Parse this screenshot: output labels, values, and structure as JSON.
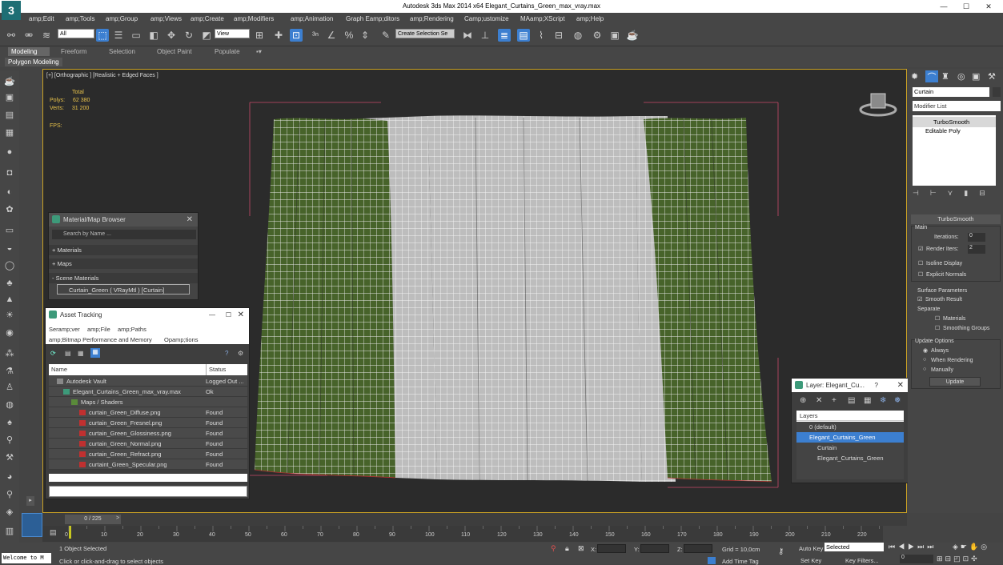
{
  "app": {
    "title": "Autodesk 3ds Max  2014 x64    Elegant_Curtains_Green_max_vray.max",
    "logo": "3"
  },
  "window_controls": {
    "minimize": "—",
    "maximize": "☐",
    "close": "✕"
  },
  "menu": [
    "amp;Edit",
    "amp;Tools",
    "amp;Group",
    "amp;Views",
    "amp;Create",
    "amp;Modifiers",
    "amp;Animation",
    "Graph Eamp;ditors",
    "amp;Rendering",
    "Camp;ustomize",
    "MAamp;XScript",
    "amp;Help"
  ],
  "toolbar": {
    "selection_filter": "All",
    "ref_coord": "View",
    "selection_set": "Create Selection Se"
  },
  "ribbon": {
    "tabs": [
      "Modeling",
      "Freeform",
      "Selection",
      "Object Paint",
      "Populate"
    ],
    "active_tab": "Modeling",
    "sub_label": "Polygon Modeling"
  },
  "viewport": {
    "label": "[+] [Orthographic ] [Realistic + Edged Faces ]",
    "stats_header": "Total",
    "polys_label": "Polys:",
    "polys_value": "62 380",
    "verts_label": "Verts:",
    "verts_value": "31 200",
    "fps_label": "FPS:"
  },
  "material_browser": {
    "title": "Material/Map Browser",
    "search_placeholder": "Search by Name ...",
    "sections": [
      "+ Materials",
      "+ Maps",
      "- Scene Materials"
    ],
    "scene_material": "Curtain_Green  ( VRayMtl )  [Curtain]"
  },
  "asset_tracking": {
    "title": "Asset Tracking",
    "menu1": [
      "Seramp;ver",
      "amp;File",
      "amp;Paths"
    ],
    "menu2": [
      "amp;Bitmap Performance and Memory",
      "Opamp;tions"
    ],
    "col_name": "Name",
    "col_status": "Status",
    "rows": [
      {
        "name": "Autodesk Vault",
        "status": "Logged Out ..."
      },
      {
        "name": "Elegant_Curtains_Green_max_vray.max",
        "status": "Ok"
      },
      {
        "name": "Maps / Shaders",
        "status": ""
      },
      {
        "name": "curtain_Green_Diffuse.png",
        "status": "Found"
      },
      {
        "name": "curtain_Green_Fresnel.png",
        "status": "Found"
      },
      {
        "name": "curtain_Green_Glossiness.png",
        "status": "Found"
      },
      {
        "name": "curtain_Green_Normal.png",
        "status": "Found"
      },
      {
        "name": "curtain_Green_Refract.png",
        "status": "Found"
      },
      {
        "name": "curtaint_Green_Specular.png",
        "status": "Found"
      }
    ]
  },
  "layer_panel": {
    "title": "Layer: Elegant_Cu...",
    "help": "?",
    "header": "Layers",
    "rows": [
      "0 (default)",
      "Elegant_Curtains_Green",
      "Curtain",
      "Elegant_Curtains_Green"
    ]
  },
  "command_panel": {
    "object_name": "Curtain",
    "modifier_list": "Modifier List",
    "stack": [
      "TurboSmooth",
      "Editable Poly"
    ],
    "rollout_title": "TurboSmooth",
    "main_group": "Main",
    "iterations_label": "Iterations:",
    "iterations_value": "0",
    "render_iters_label": "Render Iters:",
    "render_iters_value": "2",
    "isoline": "Isoline Display",
    "explicit_normals": "Explicit Normals",
    "surface_group": "Surface Parameters",
    "smooth_result": "Smooth Result",
    "separate": "Separate",
    "materials": "Materials",
    "smoothing_groups": "Smoothing Groups",
    "update_group": "Update Options",
    "always": "Always",
    "when_rendering": "When Rendering",
    "manually": "Manually",
    "update_button": "Update"
  },
  "timeline": {
    "frame": "0 / 225",
    "ticks": [
      "0",
      "10",
      "20",
      "30",
      "40",
      "50",
      "60",
      "70",
      "80",
      "90",
      "100",
      "110",
      "120",
      "130",
      "140",
      "150",
      "160",
      "170",
      "180",
      "190",
      "200",
      "210",
      "220"
    ]
  },
  "statusbar": {
    "maxscript": "Welcome to M",
    "selected": "1 Object Selected",
    "prompt": "Click or click-and-drag to select objects",
    "x_label": "X:",
    "y_label": "Y:",
    "z_label": "Z:",
    "grid": "Grid = 10,0cm",
    "add_time_tag": "Add Time Tag",
    "auto_key": "Auto Key",
    "selected_dropdown": "Selected",
    "set_key": "Set Key",
    "key_filters": "Key Filters...",
    "frame_field": "0"
  },
  "colors": {
    "accent": "#3c7fd0",
    "viewport_border": "#c8a024",
    "curtain_green": "#4d6b2c",
    "curtain_white": "#d8d8d8"
  }
}
